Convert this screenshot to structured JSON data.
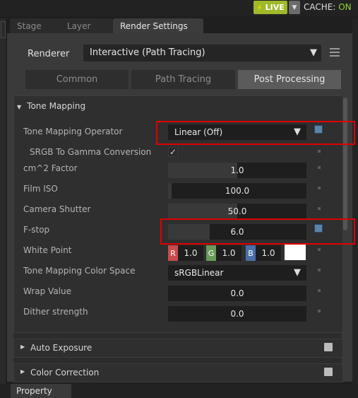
{
  "status": {
    "live_label": "LIVE",
    "live_icon": "bolt-icon",
    "cache_label": "CACHE:",
    "cache_state": "ON",
    "live_color": "#9fb92a"
  },
  "tabs": [
    {
      "label": "Stage"
    },
    {
      "label": "Layer"
    },
    {
      "label": "Render Settings"
    }
  ],
  "renderer": {
    "label": "Renderer",
    "value": "Interactive (Path Tracing)"
  },
  "subtabs": [
    {
      "label": "Common"
    },
    {
      "label": "Path Tracing"
    },
    {
      "label": "Post Processing"
    }
  ],
  "tone_mapping": {
    "header": "Tone Mapping",
    "operator": {
      "label": "Tone Mapping Operator",
      "value": "Linear (Off)"
    },
    "srgb": {
      "label": "SRGB To Gamma Conversion",
      "checked": true
    },
    "cm2": {
      "label": "cm^2 Factor",
      "value": "1.0",
      "fill": 0.5
    },
    "film_iso": {
      "label": "Film ISO",
      "value": "100.0",
      "fill": 0.025
    },
    "shutter": {
      "label": "Camera Shutter",
      "value": "50.0",
      "fill": 0.5
    },
    "fstop": {
      "label": "F-stop",
      "value": "6.0",
      "fill": 0.3
    },
    "white_point": {
      "label": "White Point",
      "r": "1.0",
      "g": "1.0",
      "b": "1.0",
      "r_label": "R",
      "g_label": "G",
      "b_label": "B",
      "r_color": "#c94b4b",
      "g_color": "#6a9a5a",
      "b_color": "#4a6fa8"
    },
    "color_space": {
      "label": "Tone Mapping Color Space",
      "value": "sRGBLinear"
    },
    "wrap": {
      "label": "Wrap Value",
      "value": "0.0"
    },
    "dither": {
      "label": "Dither strength",
      "value": "0.0"
    }
  },
  "sections": [
    {
      "label": "Auto Exposure"
    },
    {
      "label": "Color Correction"
    }
  ],
  "bottom": {
    "property_tab": "Property"
  },
  "colors": {
    "highlight": "#e00000",
    "modified_indicator": "#5a84a8"
  }
}
